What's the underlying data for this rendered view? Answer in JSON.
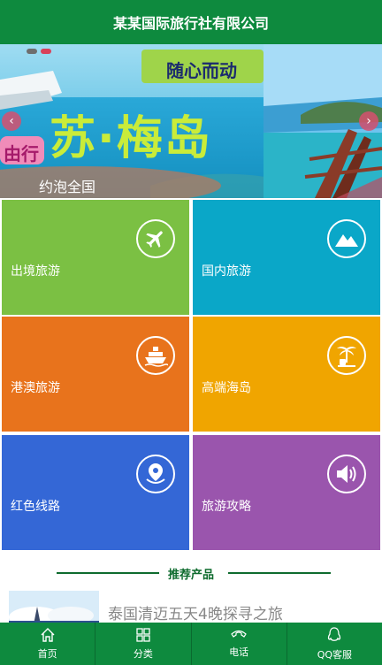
{
  "header": {
    "title": "某某国际旅行社有限公司"
  },
  "banner": {
    "slogan": "随心而动",
    "headline": "苏·梅岛",
    "side_text": "由行",
    "caption": "约泡全国",
    "prev_arrow": "‹",
    "next_arrow": "›",
    "active_slide": 2,
    "slide_count": 2
  },
  "tiles": [
    {
      "label": "出境旅游",
      "icon": "airplane-icon",
      "color": "#7bc043"
    },
    {
      "label": "国内旅游",
      "icon": "mountain-icon",
      "color": "#0aa7c8"
    },
    {
      "label": "港澳旅游",
      "icon": "ship-icon",
      "color": "#e8731c"
    },
    {
      "label": "高端海岛",
      "icon": "palm-island-icon",
      "color": "#f0a500"
    },
    {
      "label": "红色线路",
      "icon": "map-pin-icon",
      "color": "#3467d6"
    },
    {
      "label": "旅游攻略",
      "icon": "speaker-icon",
      "color": "#9a55ad"
    }
  ],
  "section": {
    "title": "推荐产品"
  },
  "products": [
    {
      "title": "泰国清迈五天4晚探寻之旅"
    }
  ],
  "tabbar": {
    "items": [
      {
        "label": "首页",
        "icon": "home-icon"
      },
      {
        "label": "分类",
        "icon": "grid-icon"
      },
      {
        "label": "电话",
        "icon": "phone-icon"
      },
      {
        "label": "QQ客服",
        "icon": "qq-penguin-icon"
      }
    ]
  },
  "colors": {
    "brand_green": "#0e8a3e"
  }
}
